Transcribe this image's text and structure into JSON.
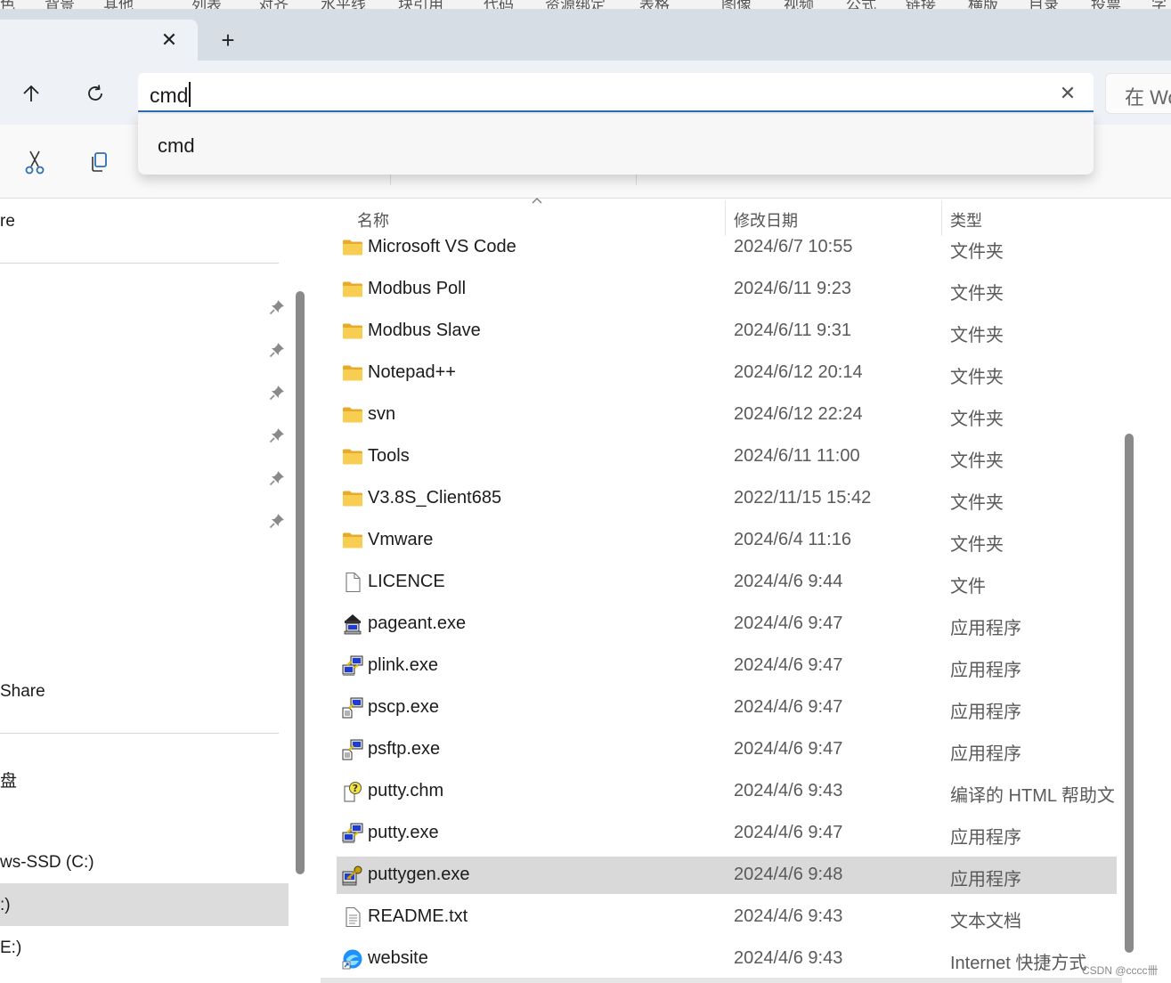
{
  "top_menu": [
    "色",
    "背景",
    "其他",
    "列表",
    "对齐",
    "水平线",
    "块引用",
    "代码",
    "资源绑定",
    "表格",
    "图像",
    "视频",
    "公式",
    "链接",
    "横版",
    "目录",
    "投票",
    "字"
  ],
  "tabs": {
    "close_glyph": "✕",
    "new_glyph": "+"
  },
  "address": {
    "value": "cmd",
    "clear_glyph": "✕",
    "search_placeholder": "在 Wo"
  },
  "suggestions": [
    "cmd"
  ],
  "nav_pane": {
    "items": [
      {
        "label": "re"
      },
      {
        "label": "Share"
      },
      {
        "label": "盘"
      },
      {
        "label": "ws-SSD (C:)"
      },
      {
        "label": ":)",
        "selected": true
      },
      {
        "label": "E:)"
      }
    ]
  },
  "columns": {
    "name": "名称",
    "date": "修改日期",
    "type": "类型"
  },
  "files": [
    {
      "name": "Microsoft VS Code",
      "date": "2024/6/7 10:55",
      "type": "文件夹",
      "icon": "folder-icon"
    },
    {
      "name": "Modbus Poll",
      "date": "2024/6/11 9:23",
      "type": "文件夹",
      "icon": "folder-icon"
    },
    {
      "name": "Modbus Slave",
      "date": "2024/6/11 9:31",
      "type": "文件夹",
      "icon": "folder-icon"
    },
    {
      "name": "Notepad++",
      "date": "2024/6/12 20:14",
      "type": "文件夹",
      "icon": "folder-icon"
    },
    {
      "name": "svn",
      "date": "2024/6/12 22:24",
      "type": "文件夹",
      "icon": "folder-icon"
    },
    {
      "name": "Tools",
      "date": "2024/6/11 11:00",
      "type": "文件夹",
      "icon": "folder-icon"
    },
    {
      "name": "V3.8S_Client685",
      "date": "2022/11/15 15:42",
      "type": "文件夹",
      "icon": "folder-icon"
    },
    {
      "name": "Vmware",
      "date": "2024/6/4 11:16",
      "type": "文件夹",
      "icon": "folder-icon"
    },
    {
      "name": "LICENCE",
      "date": "2024/4/6 9:44",
      "type": "文件",
      "icon": "file-icon"
    },
    {
      "name": "pageant.exe",
      "date": "2024/4/6 9:47",
      "type": "应用程序",
      "icon": "pageant-icon"
    },
    {
      "name": "plink.exe",
      "date": "2024/4/6 9:47",
      "type": "应用程序",
      "icon": "putty-icon"
    },
    {
      "name": "pscp.exe",
      "date": "2024/4/6 9:47",
      "type": "应用程序",
      "icon": "pscp-icon"
    },
    {
      "name": "psftp.exe",
      "date": "2024/4/6 9:47",
      "type": "应用程序",
      "icon": "pscp-icon"
    },
    {
      "name": "putty.chm",
      "date": "2024/4/6 9:43",
      "type": "编译的 HTML 帮助文...",
      "icon": "help-icon"
    },
    {
      "name": "putty.exe",
      "date": "2024/4/6 9:47",
      "type": "应用程序",
      "icon": "putty-icon"
    },
    {
      "name": "puttygen.exe",
      "date": "2024/4/6 9:48",
      "type": "应用程序",
      "icon": "puttygen-icon",
      "selected": true
    },
    {
      "name": "README.txt",
      "date": "2024/4/6 9:43",
      "type": "文本文档",
      "icon": "text-file-icon"
    },
    {
      "name": "website",
      "date": "2024/4/6 9:43",
      "type": "Internet 快捷方式",
      "icon": "internet-shortcut-icon"
    }
  ],
  "watermark": "CSDN @cccc卌",
  "colors": {
    "accent": "#2a6fb5",
    "folder": "#f4c441",
    "selection": "#d9d9d9"
  }
}
